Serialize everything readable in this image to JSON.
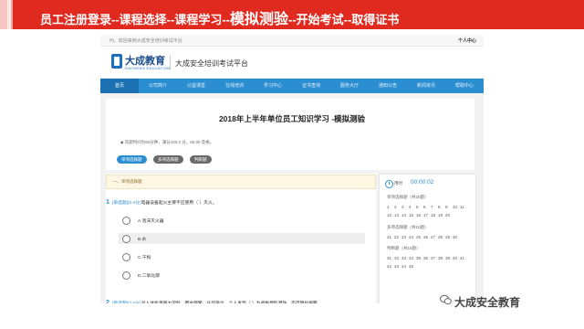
{
  "banner": {
    "title_part1": "员工注册登录--课程选择--课程学习--",
    "title_highlight": "模拟测验",
    "title_part2": "--开始考试--取得证书"
  },
  "topbar": {
    "welcome": "Hi，欢迎来到大成安全培训考试平台",
    "user_center": "个人中心"
  },
  "header": {
    "logo_cn": "大成教育",
    "logo_en": "DACHENG EDUCATION",
    "platform": "大成安全培训考试平台"
  },
  "nav": [
    "首页",
    "公司简介",
    "公益课堂",
    "在线培训",
    "学习中心",
    "证书查询",
    "服务大厅",
    "通知公告",
    "新闻资讯",
    "帮助中心"
  ],
  "exam": {
    "title": "2018年上半年单位员工知识学习 -模拟测验",
    "info": "◆ 答题时间为60分钟，满分100.0 分，60.00 及格。",
    "types": [
      {
        "label": "单项选择题",
        "color": "#2a8ed0"
      },
      {
        "label": "多项选择题",
        "color": "#6a6a6a"
      },
      {
        "label": "判断题",
        "color": "#6a6a6a"
      }
    ],
    "section_header": "一、单项选择题",
    "q1": {
      "num": "1",
      "tag": "[单选题](2.0分)",
      "text": "电器设备起火主要不应使用（       ）灭火。",
      "options": [
        "A.泡沫灭火器",
        "B.水",
        "C.干粉",
        "D.二氧化碳"
      ]
    },
    "q2": {
      "num": "2",
      "tag": "[单选题](2.0分)",
      "text": "对人体危害最大的时，都会频繁。任何单位、个人发现（      ）为避免燃料源防。不得阻拦报警。"
    }
  },
  "sidebar": {
    "timer_label": "用时",
    "timer_value": "00:00:02",
    "single_head": "单项选择题（共20题）",
    "single_nums": [
      "1",
      "2",
      "3",
      "4",
      "5",
      "6",
      "7",
      "8",
      "9",
      "10",
      "11",
      "12",
      "13",
      "14",
      "15",
      "16",
      "17",
      "18",
      "19",
      "20"
    ],
    "multi_head": "多项选择题（共10题）",
    "multi_nums": [
      "21",
      "22",
      "23",
      "24",
      "25",
      "26",
      "27",
      "28",
      "29",
      "30"
    ],
    "judge_head": "判断题（共15题）",
    "judge_nums": [
      "31",
      "32",
      "33",
      "34",
      "35",
      "36",
      "37",
      "38",
      "39",
      "40",
      "41",
      "42",
      "43",
      "44",
      "45"
    ]
  },
  "watermark": "大成安全教育"
}
